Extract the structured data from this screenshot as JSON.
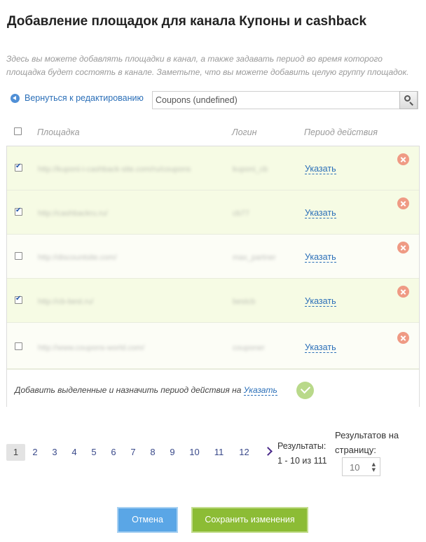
{
  "header": {
    "title": "Добавление площадок для канала Купоны и cashback",
    "description": "Здесь вы можете добавлять площадки в канал, а также задавать период во время которого площадка будет состоять в канале. Заметьте, что вы можете добавить целую группу площадок."
  },
  "toolbar": {
    "back_label": "Вернуться к редактированию",
    "search_value": "Coupons (undefined)"
  },
  "table": {
    "columns": {
      "site": "Площадка",
      "login": "Логин",
      "period": "Период действия"
    },
    "rows": [
      {
        "checked": true,
        "site": "http://kuponi-i-cashback-site.com/ru/coupons",
        "login": "kuponi_cb",
        "period_link": "Указать"
      },
      {
        "checked": true,
        "site": "http://cashbackru.ru/",
        "login": "cb77",
        "period_link": "Указать"
      },
      {
        "checked": false,
        "site": "http://discountsite.com/",
        "login": "max_partner",
        "period_link": "Указать"
      },
      {
        "checked": true,
        "site": "http://cb-best.ru/",
        "login": "bestcb",
        "period_link": "Указать"
      },
      {
        "checked": false,
        "site": "http://www.coupons-world.com/",
        "login": "couponer",
        "period_link": "Указать"
      }
    ],
    "footer": {
      "text": "Добавить выделенные и назначить период действия на ",
      "link": "Указать"
    }
  },
  "pagination": {
    "pages": [
      "1",
      "2",
      "3",
      "4",
      "5",
      "6",
      "7",
      "8",
      "9",
      "10",
      "11",
      "12"
    ],
    "current": "1",
    "results_label": "Результаты:",
    "results_range": "1 - 10 из 111",
    "per_page_label": "Результатов на страницу:",
    "per_page_value": "10"
  },
  "actions": {
    "cancel_label": "Отмена",
    "save_label": "Сохранить изменения"
  }
}
